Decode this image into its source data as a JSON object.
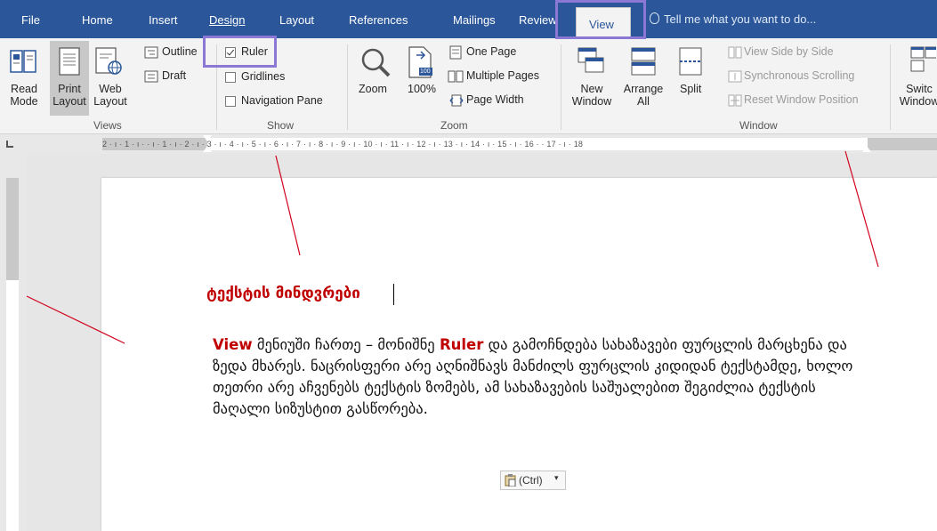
{
  "tabs": {
    "file": "File",
    "home": "Home",
    "insert": "Insert",
    "design": "Design",
    "layout": "Layout",
    "references": "References",
    "mailings": "Mailings",
    "review": "Review",
    "view": "View"
  },
  "tell_me": "Tell me what you want to do...",
  "views_group": {
    "label": "Views",
    "read_mode_line1": "Read",
    "read_mode_line2": "Mode",
    "print_layout_line1": "Print",
    "print_layout_line2": "Layout",
    "web_layout_line1": "Web",
    "web_layout_line2": "Layout",
    "outline": "Outline",
    "draft": "Draft"
  },
  "show_group": {
    "label": "Show",
    "ruler": "Ruler",
    "ruler_checked": true,
    "gridlines": "Gridlines",
    "navigation_pane": "Navigation Pane"
  },
  "zoom_group": {
    "label": "Zoom",
    "zoom": "Zoom",
    "hundred": "100%",
    "one_page": "One Page",
    "multiple_pages": "Multiple Pages",
    "page_width": "Page Width",
    "icon_badge": "100"
  },
  "window_group": {
    "label": "Window",
    "new_window_line1": "New",
    "new_window_line2": "Window",
    "arrange_all_line1": "Arrange",
    "arrange_all_line2": "All",
    "split": "Split",
    "view_side_by_side": "View Side by Side",
    "synchronous_scrolling": "Synchronous Scrolling",
    "reset_window_position": "Reset Window Position",
    "switch_windows_line1": "Switc",
    "switch_windows_line2": "Window"
  },
  "ruler": {
    "corner_label": "L",
    "h_ticks": "2 · ı · 1 · ı ·     · ı · 1 · ı · 2 · ı · 3 · ı · 4 · ı · 5 · ı · 6 · ı · 7 · ı · 8 · ı · 9 · ı · 10 · ı · 11 · ı · 12 · ı · 13 · ı · 14 · ı · 15 · ı · 16 ·     · 17 · ı · 18"
  },
  "document": {
    "title": "ტექსტის მინდვრები",
    "para_pre": "მენიუში ჩართე – მონიშნე",
    "view_word": "View",
    "ruler_word": "Ruler",
    "para_post": "და გამოჩნდება სახაზავები ფურცლის მარცხენა და ზედა მხარეს. ნაცრისფერი არე აღნიშნავს მანძილს ფურცლის კიდიდან ტექსტამდე, ხოლო თეთრი არე აჩვენებს ტექსტის ზომებს, ამ სახაზავების საშუალებით შეგიძლია ტექსტის მაღალი სიზუსტით გასწორება."
  },
  "paste_options": "(Ctrl)",
  "colors": {
    "ribbon_blue": "#2b579a",
    "highlight": "#8b78d4",
    "annotation_red": "#d0021b",
    "title_red": "#c00000"
  }
}
